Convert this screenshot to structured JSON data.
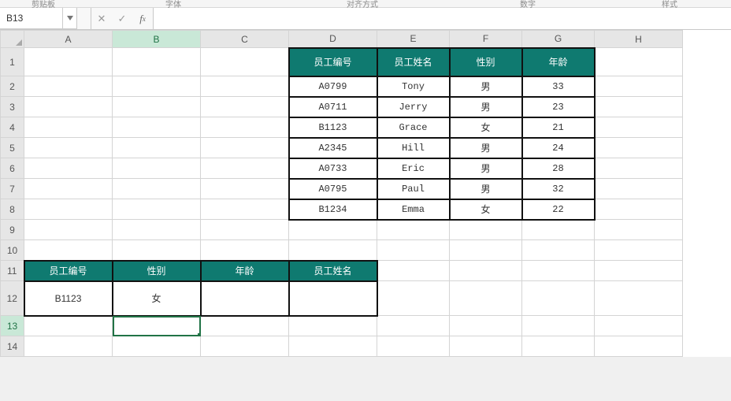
{
  "ribbon": {
    "snippets": [
      "剪贴板",
      "字体",
      "对齐方式",
      "数字",
      "样式"
    ]
  },
  "namebox": {
    "ref": "B13"
  },
  "formula": {
    "value": ""
  },
  "columns": [
    "A",
    "B",
    "C",
    "D",
    "E",
    "F",
    "G",
    "H"
  ],
  "rows": [
    "1",
    "2",
    "3",
    "4",
    "5",
    "6",
    "7",
    "8",
    "9",
    "10",
    "11",
    "12",
    "13",
    "14"
  ],
  "table1": {
    "headers": [
      "员工编号",
      "员工姓名",
      "性别",
      "年龄"
    ],
    "rows": [
      {
        "id": "A0799",
        "name": "Tony",
        "sex": "男",
        "age": "33"
      },
      {
        "id": "A0711",
        "name": "Jerry",
        "sex": "男",
        "age": "23"
      },
      {
        "id": "B1123",
        "name": "Grace",
        "sex": "女",
        "age": "21"
      },
      {
        "id": "A2345",
        "name": "Hill",
        "sex": "男",
        "age": "24"
      },
      {
        "id": "A0733",
        "name": "Eric",
        "sex": "男",
        "age": "28"
      },
      {
        "id": "A0795",
        "name": "Paul",
        "sex": "男",
        "age": "32"
      },
      {
        "id": "B1234",
        "name": "Emma",
        "sex": "女",
        "age": "22"
      }
    ]
  },
  "table2": {
    "headers": [
      "员工编号",
      "性别",
      "年龄",
      "员工姓名"
    ],
    "row": {
      "id": "B1123",
      "sex": "女",
      "age": "",
      "name": ""
    }
  },
  "active_cell": "B13"
}
